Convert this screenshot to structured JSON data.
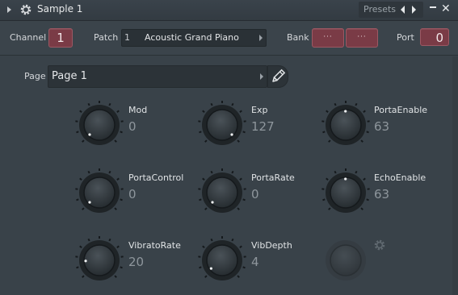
{
  "titlebar": {
    "title": "Sample 1",
    "presets_label": "Presets"
  },
  "controls": {
    "channel_label": "Channel",
    "channel_value": "1",
    "patch_label": "Patch",
    "patch_number": "1",
    "patch_name": "Acoustic Grand Piano",
    "bank_label": "Bank",
    "bank_msb": "···",
    "bank_lsb": "···",
    "port_label": "Port",
    "port_value": "0"
  },
  "page": {
    "label": "Page",
    "value": "Page 1"
  },
  "knobs": [
    {
      "name": "Mod",
      "value": "0",
      "level": 0.0
    },
    {
      "name": "Exp",
      "value": "127",
      "level": 1.0
    },
    {
      "name": "PortaEnable",
      "value": "63",
      "level": 0.496
    },
    {
      "name": "PortaControl",
      "value": "0",
      "level": 0.0
    },
    {
      "name": "PortaRate",
      "value": "0",
      "level": 0.0
    },
    {
      "name": "EchoEnable",
      "value": "63",
      "level": 0.496
    },
    {
      "name": "VibratoRate",
      "value": "20",
      "level": 0.157
    },
    {
      "name": "VibDepth",
      "value": "4",
      "level": 0.031
    }
  ],
  "icons": {
    "settings": "gear-icon",
    "page_edit": "pencil-icon"
  }
}
